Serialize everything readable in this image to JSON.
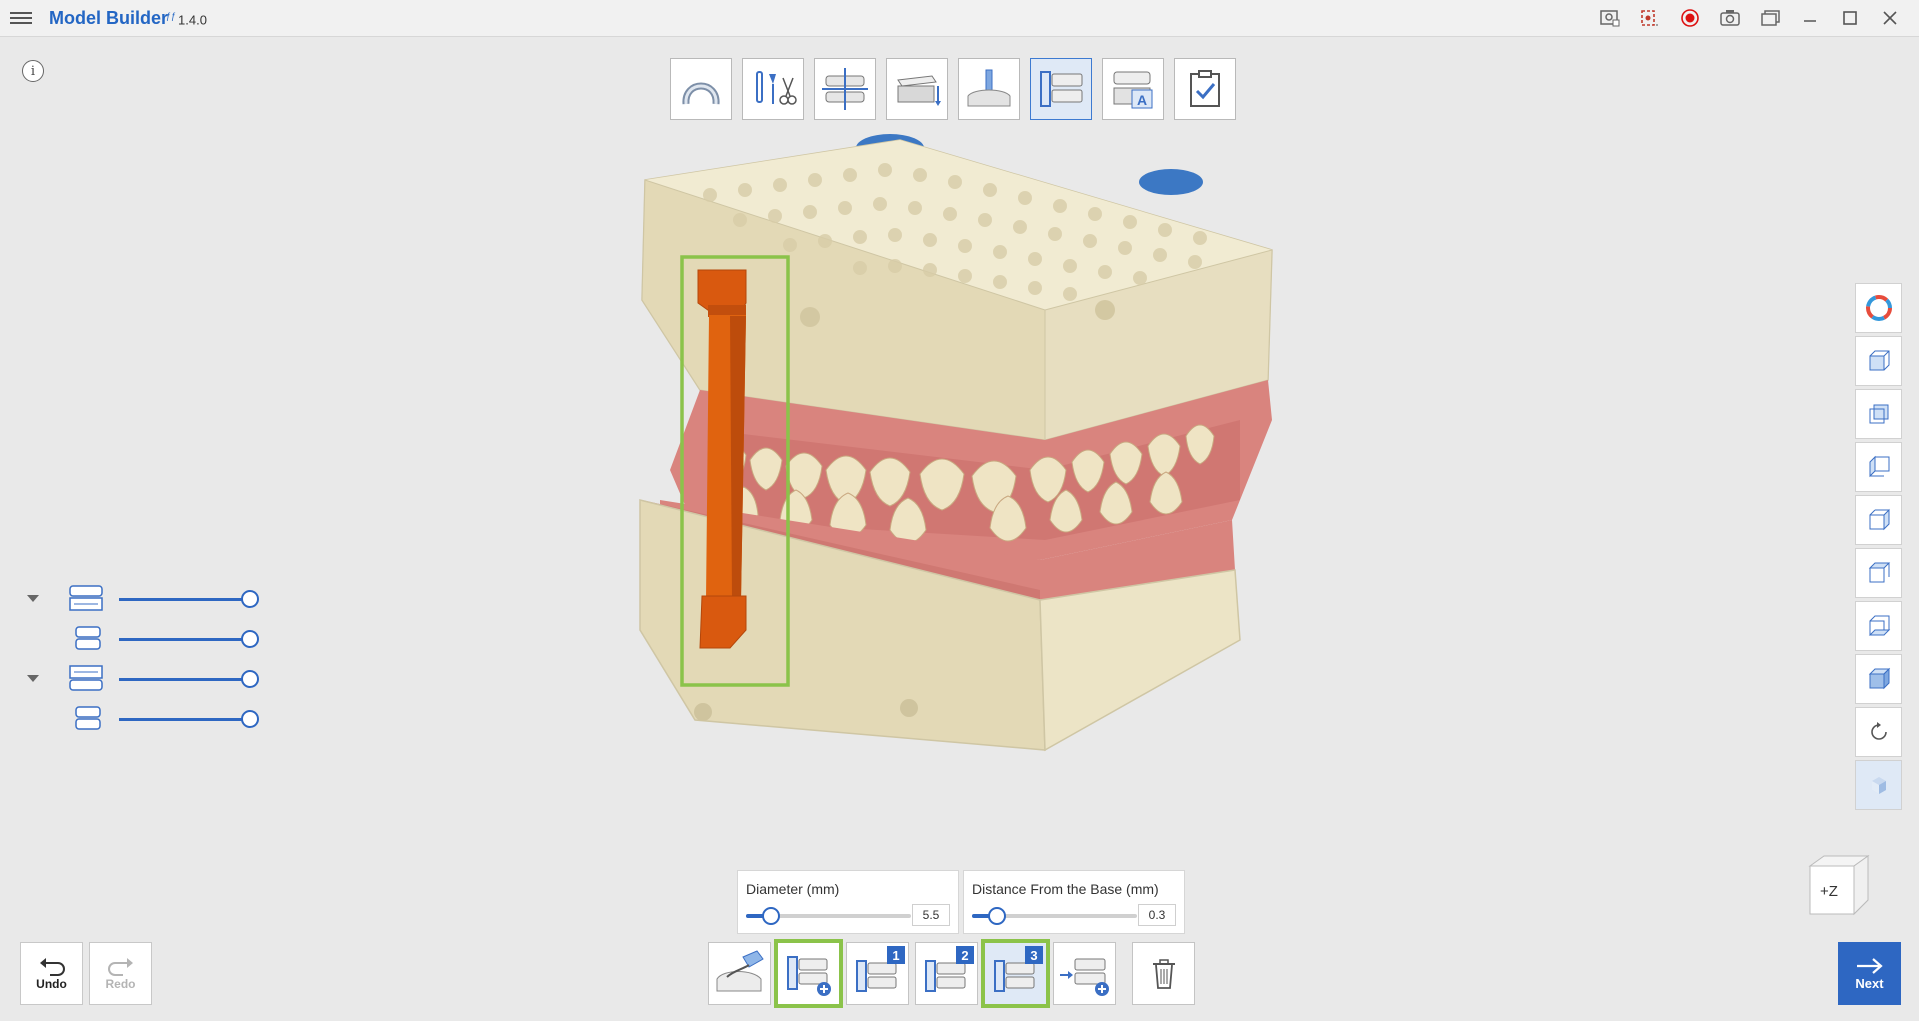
{
  "app": {
    "title": "Model Builder",
    "version_mark": "ƒƒ",
    "version": "1.4.0"
  },
  "titlebar_icons": [
    "screen-capture-icon",
    "record-region-icon",
    "record-icon",
    "camera-icon",
    "gallery-icon",
    "minimize-icon",
    "maximize-icon",
    "close-icon"
  ],
  "steps": [
    {
      "name": "step-arch",
      "icon": "arch-icon",
      "active": false
    },
    {
      "name": "step-tools",
      "icon": "trim-tools-icon",
      "active": false
    },
    {
      "name": "step-align",
      "icon": "align-icon",
      "active": false
    },
    {
      "name": "step-base",
      "icon": "base-icon",
      "active": false
    },
    {
      "name": "step-die",
      "icon": "die-icon",
      "active": false
    },
    {
      "name": "step-connector",
      "icon": "connector-icon",
      "active": true
    },
    {
      "name": "step-label",
      "icon": "label-icon",
      "active": false
    },
    {
      "name": "step-complete",
      "icon": "check-icon",
      "active": false
    }
  ],
  "layers": [
    {
      "name": "upper-model",
      "expandable": true,
      "opacity": 1.0
    },
    {
      "name": "upper-scan",
      "expandable": false,
      "opacity": 1.0
    },
    {
      "name": "lower-model",
      "expandable": true,
      "opacity": 1.0
    },
    {
      "name": "lower-scan",
      "expandable": false,
      "opacity": 1.0
    }
  ],
  "params": {
    "diameter": {
      "label": "Diameter (mm)",
      "value": "5.5",
      "fraction": 0.15
    },
    "distance": {
      "label": "Distance From the Base (mm)",
      "value": "0.3",
      "fraction": 0.15
    }
  },
  "bottom": {
    "undo_label": "Undo",
    "redo_label": "Redo",
    "next_label": "Next",
    "tools": [
      {
        "name": "brush-tool",
        "num": "",
        "active": false
      },
      {
        "name": "add-connector-tool",
        "num": "",
        "active": false
      },
      {
        "name": "connector-preset-1",
        "num": "1",
        "active": false
      },
      {
        "name": "connector-preset-2",
        "num": "2",
        "active": false
      },
      {
        "name": "connector-preset-3",
        "num": "3",
        "active": true
      },
      {
        "name": "move-connector-tool",
        "num": "",
        "active": false
      },
      {
        "name": "delete-tool",
        "num": "",
        "active": false
      }
    ]
  },
  "orientation": {
    "label": "+Z"
  },
  "colors": {
    "accent": "#2e67c2",
    "highlight": "#8bc34a",
    "connector": "#d9590f",
    "base": "#ece4c6",
    "gum": "#d9847e"
  }
}
